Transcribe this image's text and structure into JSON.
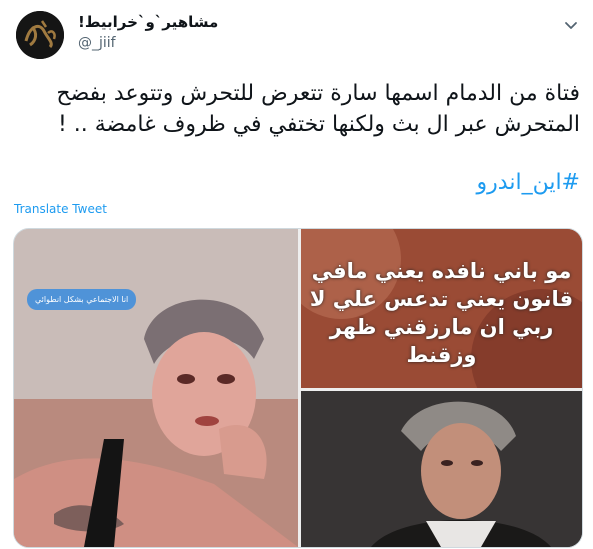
{
  "author": {
    "display_name": "مشاهير`و`خرابيط!",
    "handle": "@_jiif"
  },
  "tweet": {
    "text": "فتاة من الدمام اسمها سارة تتعرض للتحرش وتتوعد بفضح المتحرش عبر ال بث ولكنها تختفي في ظروف غامضة .. !",
    "hashtag": "#اين_اندرو",
    "translate_label": "Translate Tweet"
  },
  "media": {
    "left_bubble_text": "انا الاجتماعي بشكل انطوائي",
    "top_right_text": "مو باني نافده يعني مافي قانون يعني تدعس علي لا ربي ان مارزقني ظهر وزقنط"
  },
  "colors": {
    "link": "#1d9bf0",
    "secondary": "#536471"
  },
  "icons": {
    "more": "chevron-down-icon",
    "avatar": "calligraphy-logo"
  }
}
